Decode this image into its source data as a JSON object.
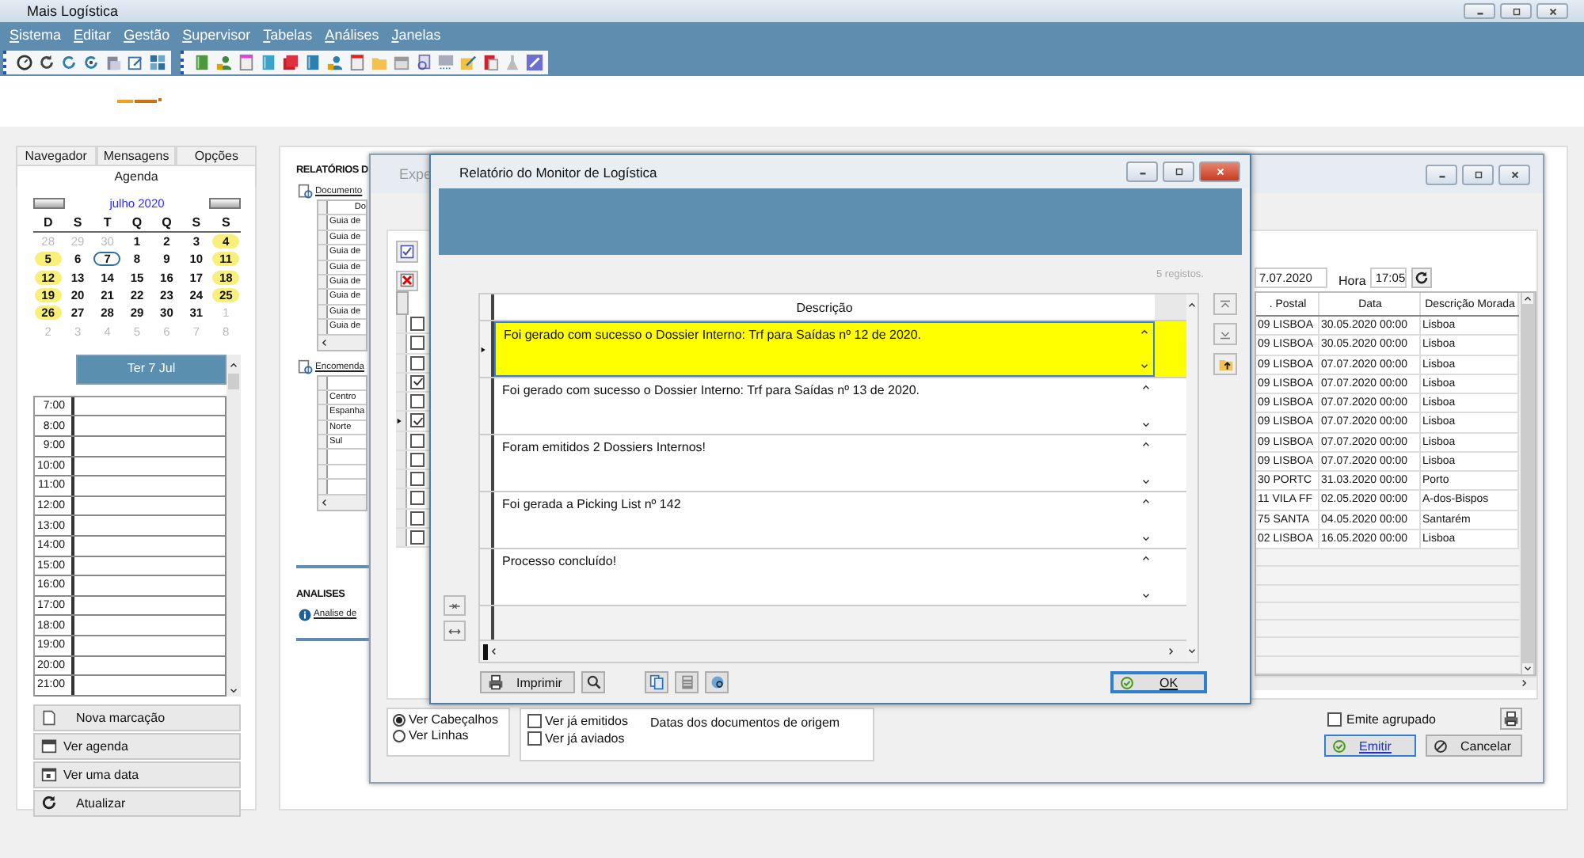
{
  "window": {
    "title": "Mais Logística"
  },
  "menu": [
    "Sistema",
    "Editar",
    "Gestão",
    "Supervisor",
    "Tabelas",
    "Análises",
    "Janelas"
  ],
  "agenda": {
    "tabs": [
      {
        "label": "Navegador",
        "selected": false
      },
      {
        "label": "Mensagens",
        "selected": false
      },
      {
        "label": "Opções",
        "selected": false
      },
      {
        "label": "Agenda",
        "selected": true
      }
    ],
    "month": "julho 2020",
    "weekdays": [
      "D",
      "S",
      "T",
      "Q",
      "Q",
      "S",
      "S"
    ],
    "weeks": [
      [
        {
          "label": "28",
          "muted": true,
          "marked": false,
          "selected": false
        },
        {
          "label": "29",
          "muted": true,
          "marked": false,
          "selected": false
        },
        {
          "label": "30",
          "muted": true,
          "marked": false,
          "selected": false
        },
        {
          "label": "1",
          "muted": false,
          "marked": false,
          "selected": false
        },
        {
          "label": "2",
          "muted": false,
          "marked": false,
          "selected": false
        },
        {
          "label": "3",
          "muted": false,
          "marked": false,
          "selected": false
        },
        {
          "label": "4",
          "muted": false,
          "marked": true,
          "selected": false
        }
      ],
      [
        {
          "label": "5",
          "muted": false,
          "marked": true,
          "selected": false
        },
        {
          "label": "6",
          "muted": false,
          "marked": false,
          "selected": false
        },
        {
          "label": "7",
          "muted": false,
          "marked": false,
          "selected": true
        },
        {
          "label": "8",
          "muted": false,
          "marked": false,
          "selected": false
        },
        {
          "label": "9",
          "muted": false,
          "marked": false,
          "selected": false
        },
        {
          "label": "10",
          "muted": false,
          "marked": false,
          "selected": false
        },
        {
          "label": "11",
          "muted": false,
          "marked": true,
          "selected": false
        }
      ],
      [
        {
          "label": "12",
          "muted": false,
          "marked": true,
          "selected": false
        },
        {
          "label": "13",
          "muted": false,
          "marked": false,
          "selected": false
        },
        {
          "label": "14",
          "muted": false,
          "marked": false,
          "selected": false
        },
        {
          "label": "15",
          "muted": false,
          "marked": false,
          "selected": false
        },
        {
          "label": "16",
          "muted": false,
          "marked": false,
          "selected": false
        },
        {
          "label": "17",
          "muted": false,
          "marked": false,
          "selected": false
        },
        {
          "label": "18",
          "muted": false,
          "marked": true,
          "selected": false
        }
      ],
      [
        {
          "label": "19",
          "muted": false,
          "marked": true,
          "selected": false
        },
        {
          "label": "20",
          "muted": false,
          "marked": false,
          "selected": false
        },
        {
          "label": "21",
          "muted": false,
          "marked": false,
          "selected": false
        },
        {
          "label": "22",
          "muted": false,
          "marked": false,
          "selected": false
        },
        {
          "label": "23",
          "muted": false,
          "marked": false,
          "selected": false
        },
        {
          "label": "24",
          "muted": false,
          "marked": false,
          "selected": false
        },
        {
          "label": "25",
          "muted": false,
          "marked": true,
          "selected": false
        }
      ],
      [
        {
          "label": "26",
          "muted": false,
          "marked": true,
          "selected": false
        },
        {
          "label": "27",
          "muted": false,
          "marked": false,
          "selected": false
        },
        {
          "label": "28",
          "muted": false,
          "marked": false,
          "selected": false
        },
        {
          "label": "29",
          "muted": false,
          "marked": false,
          "selected": false
        },
        {
          "label": "30",
          "muted": false,
          "marked": false,
          "selected": false
        },
        {
          "label": "31",
          "muted": false,
          "marked": false,
          "selected": false
        },
        {
          "label": "1",
          "muted": true,
          "marked": false,
          "selected": false
        }
      ],
      [
        {
          "label": "2",
          "muted": true,
          "marked": false,
          "selected": false
        },
        {
          "label": "3",
          "muted": true,
          "marked": false,
          "selected": false
        },
        {
          "label": "4",
          "muted": true,
          "marked": false,
          "selected": false
        },
        {
          "label": "5",
          "muted": true,
          "marked": false,
          "selected": false
        },
        {
          "label": "6",
          "muted": true,
          "marked": false,
          "selected": false
        },
        {
          "label": "7",
          "muted": true,
          "marked": false,
          "selected": false
        },
        {
          "label": "8",
          "muted": true,
          "marked": false,
          "selected": false
        }
      ]
    ],
    "day_title": "Ter 7 Jul",
    "hours": [
      "7:00",
      "8:00",
      "9:00",
      "10:00",
      "11:00",
      "12:00",
      "13:00",
      "14:00",
      "15:00",
      "16:00",
      "17:00",
      "18:00",
      "19:00",
      "20:00",
      "21:00"
    ],
    "actions": [
      "Nova marcação",
      "Ver agenda",
      "Ver uma data",
      "Atualizar"
    ]
  },
  "reports": {
    "title": "RELATÓRIOS D",
    "documents": {
      "link": "Documento",
      "column_1": "Do",
      "rows": [
        "Guia de",
        "Guia de",
        "Guia de",
        "Guia de",
        "Guia de",
        "Guia de",
        "Guia de",
        "Guia de"
      ]
    },
    "orders": {
      "link": "Encomenda",
      "rows": [
        "Centro",
        "Espanha",
        "Norte",
        "Sul"
      ]
    },
    "analyses": {
      "title": "ANALISES",
      "link": "Analise de"
    }
  },
  "shipping": {
    "title": "Expe",
    "date_field": "7.07.2020",
    "hour_label": "Hora",
    "hour_field": "17:05",
    "columns": [
      ". Postal",
      "Data",
      "Descrição Morada"
    ],
    "rows": [
      {
        "checked": false,
        "current": false,
        "postal": "09 LISBOA",
        "date": "30.05.2020 00:00",
        "address": "Lisboa"
      },
      {
        "checked": false,
        "current": false,
        "postal": "09 LISBOA",
        "date": "30.05.2020 00:00",
        "address": "Lisboa"
      },
      {
        "checked": false,
        "current": false,
        "postal": "09 LISBOA",
        "date": "07.07.2020 00:00",
        "address": "Lisboa"
      },
      {
        "checked": true,
        "current": false,
        "postal": "09 LISBOA",
        "date": "07.07.2020 00:00",
        "address": "Lisboa"
      },
      {
        "checked": false,
        "current": false,
        "postal": "09 LISBOA",
        "date": "07.07.2020 00:00",
        "address": "Lisboa"
      },
      {
        "checked": true,
        "current": true,
        "postal": "09 LISBOA",
        "date": "07.07.2020 00:00",
        "address": "Lisboa"
      },
      {
        "checked": false,
        "current": false,
        "postal": "09 LISBOA",
        "date": "07.07.2020 00:00",
        "address": "Lisboa"
      },
      {
        "checked": false,
        "current": false,
        "postal": "09 LISBOA",
        "date": "07.07.2020 00:00",
        "address": "Lisboa"
      },
      {
        "checked": false,
        "current": false,
        "postal": "30 PORTC",
        "date": "31.03.2020 00:00",
        "address": "Porto"
      },
      {
        "checked": false,
        "current": false,
        "postal": "11 VILA FF",
        "date": "02.05.2020 00:00",
        "address": "A-dos-Bispos"
      },
      {
        "checked": false,
        "current": false,
        "postal": "75 SANTA",
        "date": "04.05.2020 00:00",
        "address": "Santarém"
      },
      {
        "checked": false,
        "current": false,
        "postal": "02 LISBOA",
        "date": "16.05.2020 00:00",
        "address": "Lisboa"
      }
    ],
    "view_options": [
      {
        "label": "Ver Cabeçalhos",
        "selected": true
      },
      {
        "label": "Ver Linhas",
        "selected": false
      }
    ],
    "filters": [
      {
        "label": "Ver já emitidos",
        "checked": false
      },
      {
        "label": "Ver já aviados",
        "checked": false
      }
    ],
    "dates_label": "Datas dos documentos de origem",
    "group_option": {
      "label": "Emite agrupado",
      "checked": false
    },
    "emit_button": "Emitir",
    "cancel_button": "Cancelar"
  },
  "dialog": {
    "title": "Relatório do Monitor de Logística",
    "count": "5 registos.",
    "column": "Descrição",
    "rows": [
      {
        "text": "Foi gerado com sucesso o Dossier Interno: Trf para Saídas nº 12 de 2020.",
        "selected": true
      },
      {
        "text": "Foi gerado com sucesso o Dossier Interno: Trf para Saídas nº 13 de 2020.",
        "selected": false
      },
      {
        "text": "Foram emitidos 2 Dossiers Internos!",
        "selected": false
      },
      {
        "text": "Foi gerada a Picking List nº 142",
        "selected": false
      },
      {
        "text": "Processo concluído!",
        "selected": false
      }
    ],
    "print_button": "Imprimir",
    "ok_button": "OK"
  }
}
